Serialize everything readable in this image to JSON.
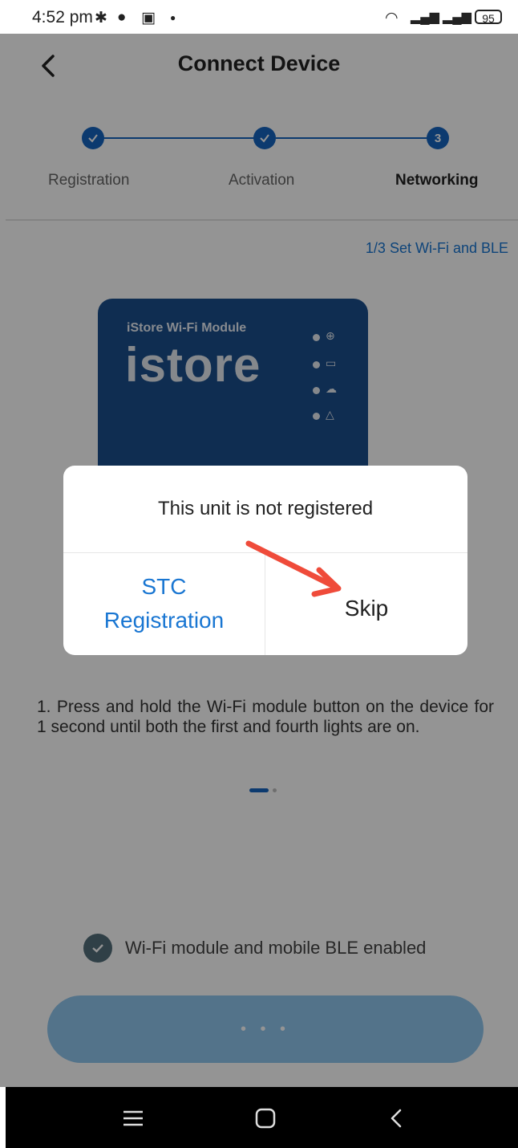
{
  "status_bar": {
    "time": "4:52 pm",
    "battery": "95"
  },
  "header": {
    "title": "Connect Device"
  },
  "stepper": {
    "steps": [
      {
        "label": "Registration",
        "state": "done"
      },
      {
        "label": "Activation",
        "state": "done"
      },
      {
        "label": "Networking",
        "state": "current",
        "number": "3"
      }
    ]
  },
  "sub_step": "1/3 Set Wi-Fi and BLE",
  "module": {
    "title": "iStore Wi-Fi Module",
    "brand": "istore",
    "led_icons": [
      "globe-icon",
      "router-icon",
      "cloud-icon",
      "warning-icon"
    ]
  },
  "instruction": "1. Press and hold the Wi-Fi module button on the device for 1 second until both the first and fourth lights are on.",
  "pager": {
    "total": 2,
    "active": 1
  },
  "confirm": {
    "label": "Wi-Fi module and mobile BLE enabled",
    "checked": true
  },
  "primary_button": {
    "label": "• • •"
  },
  "dialog": {
    "message": "This unit is not registered",
    "stc_label": "STC Registration",
    "skip_label": "Skip"
  },
  "colors": {
    "accent": "#1565c0",
    "link": "#1976d2",
    "annotation_arrow": "#ef4b3a"
  }
}
